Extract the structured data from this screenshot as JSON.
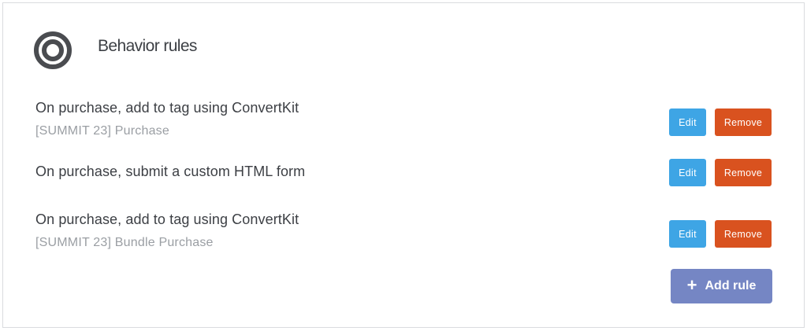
{
  "header": {
    "icon": "target-icon",
    "title": "Behavior rules"
  },
  "rules": [
    {
      "title": "On purchase, add to tag using ConvertKit",
      "subtitle": "[SUMMIT 23] Purchase",
      "edit_label": "Edit",
      "remove_label": "Remove"
    },
    {
      "title": "On purchase, submit a custom HTML form",
      "subtitle": "",
      "edit_label": "Edit",
      "remove_label": "Remove"
    },
    {
      "title": "On purchase, add to tag using ConvertKit",
      "subtitle": "[SUMMIT 23] Bundle Purchase",
      "edit_label": "Edit",
      "remove_label": "Remove"
    }
  ],
  "add_rule": {
    "icon": "plus-icon",
    "label": "Add rule"
  },
  "colors": {
    "edit": "#3ea5e5",
    "remove": "#d9521f",
    "add": "#7586c4",
    "icon": "#4a4c50"
  }
}
